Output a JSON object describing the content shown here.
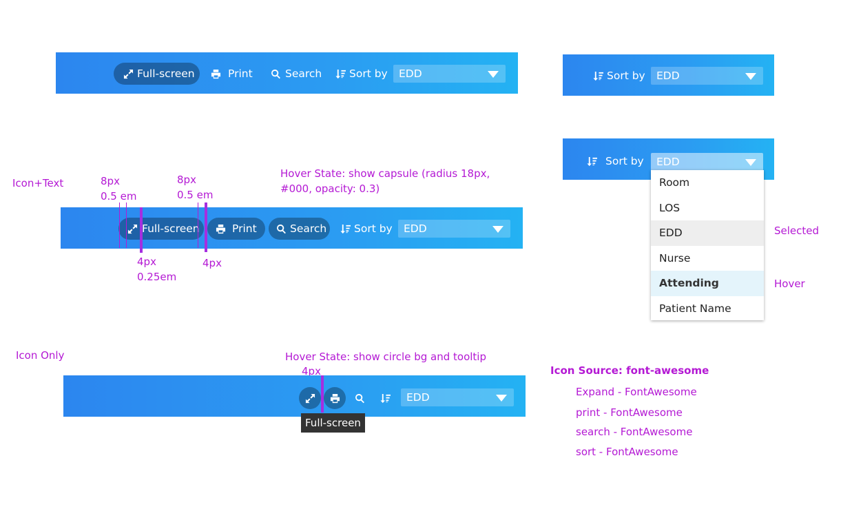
{
  "toolbar": {
    "fullscreen_label": "Full-screen",
    "print_label": "Print",
    "search_label": "Search",
    "sortby_label": "Sort by",
    "sort_value": "EDD"
  },
  "dropdown": {
    "options": [
      "Room",
      "LOS",
      "EDD",
      "Nurse",
      "Attending",
      "Patient Name"
    ],
    "selected": "EDD",
    "hovered": "Attending"
  },
  "annotations": {
    "icon_text": "Icon+Text",
    "spacing_8px": "8px",
    "spacing_05em": "0.5 em",
    "spacing_4px": "4px",
    "spacing_025em": "0.25em",
    "hover_capsule_line1": "Hover State: show capsule (radius 18px,",
    "hover_capsule_line2": "#000, opacity: 0.3)",
    "icon_only": "Icon Only",
    "hover_circle": "Hover State:  show circle bg and tooltip",
    "selected": "Selected",
    "hover": "Hover",
    "icon_source_title": "Icon Source: font-awesome",
    "icon_sources": [
      "Expand - FontAwesome",
      "print - FontAwesome",
      "search - FontAwesome",
      "sort - FontAwesome"
    ]
  },
  "tooltip": {
    "text": "Full-screen"
  },
  "colors": {
    "accent_annotation": "#b419d4",
    "bar_start": "#2c86ef",
    "bar_end": "#24b2f3"
  },
  "icons": {
    "expand": "expand-icon",
    "print": "print-icon",
    "search": "search-icon",
    "sort": "sort-icon"
  }
}
